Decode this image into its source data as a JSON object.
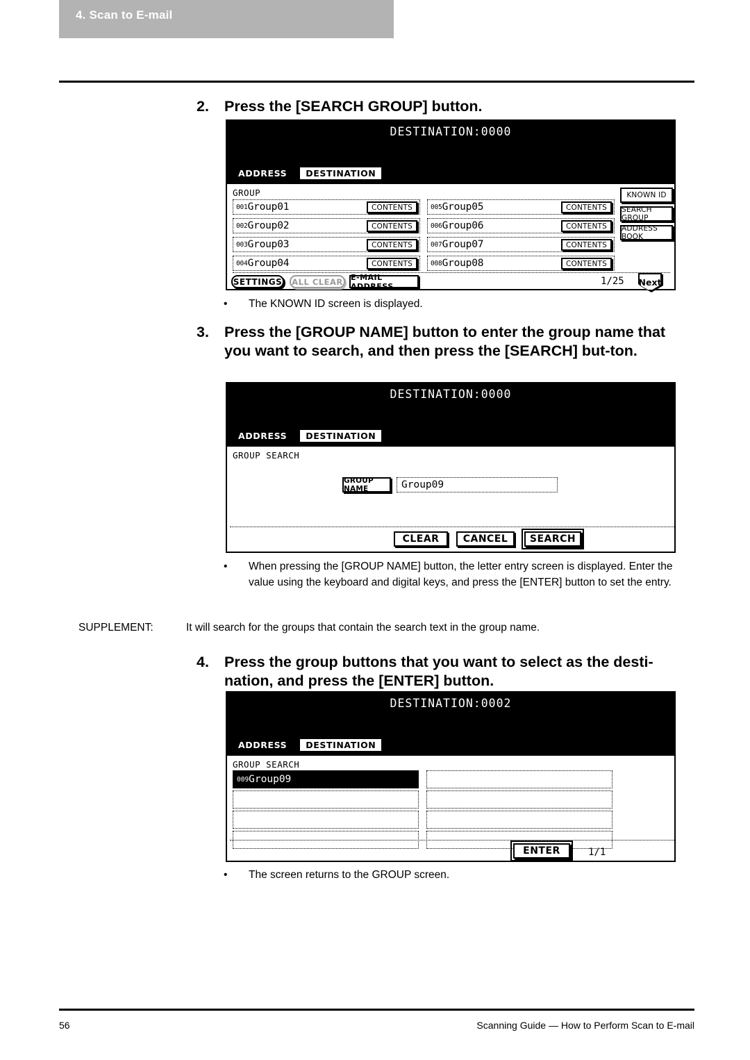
{
  "header": {
    "chapter_label": "4. Scan to E-mail"
  },
  "footer": {
    "page_number": "56",
    "title": "Scanning Guide — How to Perform Scan to E-mail"
  },
  "steps": [
    {
      "number": "2.",
      "text": "Press the [SEARCH GROUP] button."
    },
    {
      "number": "3.",
      "text": "Press the [GROUP NAME] button to enter the group name that you want to search, and then press the [SEARCH] but-ton."
    },
    {
      "number": "4.",
      "text": "Press the group buttons that you want to select as the desti-nation, and press the [ENTER] button."
    }
  ],
  "bullets": {
    "after_step2": "The KNOWN ID screen is displayed.",
    "after_step3": "When pressing the [GROUP NAME] button, the letter entry screen is displayed.  Enter the value using the keyboard and digital keys, and press the [ENTER] button to set the entry.",
    "after_step4": "The screen returns to the GROUP screen.",
    "marker": "•"
  },
  "supplement": {
    "label": "SUPPLEMENT:",
    "text": "It will search for the groups that contain the search text in the group name."
  },
  "panel1": {
    "title": "DESTINATION:0000",
    "tabs": [
      {
        "label": "ADDRESS",
        "state": "active"
      },
      {
        "label": "DESTINATION",
        "state": "inactive"
      }
    ],
    "section_label": "GROUP",
    "contents_label": "CONTENTS",
    "groups_left": [
      {
        "num": "001",
        "name": "Group01"
      },
      {
        "num": "002",
        "name": "Group02"
      },
      {
        "num": "003",
        "name": "Group03"
      },
      {
        "num": "004",
        "name": "Group04"
      }
    ],
    "groups_right": [
      {
        "num": "005",
        "name": "Group05"
      },
      {
        "num": "006",
        "name": "Group06"
      },
      {
        "num": "007",
        "name": "Group07"
      },
      {
        "num": "008",
        "name": "Group08"
      }
    ],
    "side_buttons": [
      {
        "label": "KNOWN ID"
      },
      {
        "label": "SEARCH GROUP"
      },
      {
        "label": "ADDRESS BOOK"
      }
    ],
    "bottom_buttons": [
      {
        "label": "SETTINGS",
        "state": "enabled"
      },
      {
        "label": "ALL CLEAR",
        "state": "disabled"
      },
      {
        "label": "E-MAIL ADDRESS",
        "state": "enabled"
      }
    ],
    "page_indicator": "1/25",
    "next_label": "Next"
  },
  "panel2": {
    "title": "DESTINATION:0000",
    "tabs": [
      {
        "label": "ADDRESS",
        "state": "active"
      },
      {
        "label": "DESTINATION",
        "state": "inactive"
      }
    ],
    "section_label": "GROUP SEARCH",
    "group_name_button": "GROUP NAME",
    "group_name_value": "Group09",
    "buttons": [
      {
        "label": "CLEAR",
        "state": "enabled"
      },
      {
        "label": "CANCEL",
        "state": "enabled"
      },
      {
        "label": "SEARCH",
        "state": "emphasized"
      }
    ]
  },
  "panel3": {
    "title": "DESTINATION:0002",
    "tabs": [
      {
        "label": "ADDRESS",
        "state": "active"
      },
      {
        "label": "DESTINATION",
        "state": "inactive"
      }
    ],
    "section_label": "GROUP SEARCH",
    "results_left": [
      {
        "num": "009",
        "name": "Group09",
        "selected": true
      },
      {
        "num": "",
        "name": "",
        "selected": false
      },
      {
        "num": "",
        "name": "",
        "selected": false
      },
      {
        "num": "",
        "name": "",
        "selected": false
      }
    ],
    "results_right": [
      {
        "num": "",
        "name": "",
        "selected": false
      },
      {
        "num": "",
        "name": "",
        "selected": false
      },
      {
        "num": "",
        "name": "",
        "selected": false
      },
      {
        "num": "",
        "name": "",
        "selected": false
      }
    ],
    "enter_label": "ENTER",
    "page_indicator": "1/1"
  }
}
